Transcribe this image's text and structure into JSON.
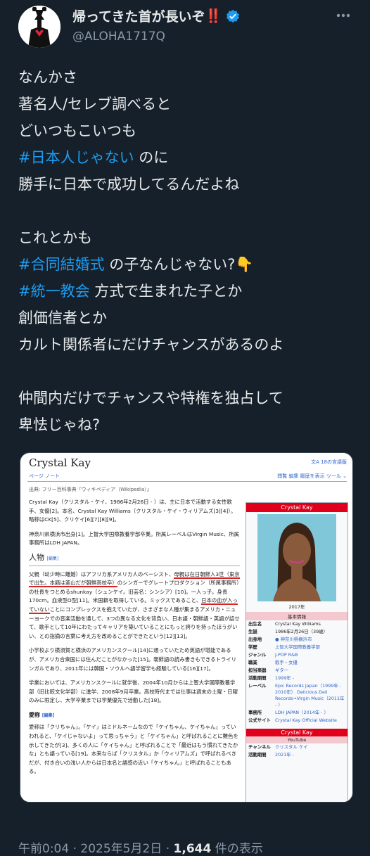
{
  "user": {
    "name": "帰ってきた首が長いぞ",
    "name_emoji": "‼️",
    "handle": "@ALOHA1717Q"
  },
  "tweet": {
    "lines": [
      {
        "parts": [
          {
            "t": "なんかさ"
          }
        ]
      },
      {
        "parts": [
          {
            "t": "著名人/セレブ調べると"
          }
        ]
      },
      {
        "parts": [
          {
            "t": "どいつもこいつも"
          }
        ]
      },
      {
        "parts": [
          {
            "t": "#日本人じゃない",
            "tag": true
          },
          {
            "t": " のに"
          }
        ]
      },
      {
        "parts": [
          {
            "t": "勝手に日本で成功してるんだよね"
          }
        ]
      },
      {
        "gap": true
      },
      {
        "parts": [
          {
            "t": "これとかも"
          }
        ]
      },
      {
        "parts": [
          {
            "t": "#合同結婚式",
            "tag": true
          },
          {
            "t": " の子なんじゃない?👇"
          }
        ]
      },
      {
        "parts": [
          {
            "t": "#統一教会",
            "tag": true
          },
          {
            "t": " 方式で生まれた子とか"
          }
        ]
      },
      {
        "parts": [
          {
            "t": "創価信者とか"
          }
        ]
      },
      {
        "parts": [
          {
            "t": "カルト関係者にだけチャンスがあるのよ"
          }
        ]
      },
      {
        "gap": true
      },
      {
        "parts": [
          {
            "t": "仲間内だけでチャンスや特権を独占して"
          }
        ]
      },
      {
        "parts": [
          {
            "t": "卑怯じゃね?"
          }
        ]
      }
    ]
  },
  "wiki": {
    "title": "Crystal Kay",
    "lang": "文A 18の言語版",
    "tabs_left": "ページ  ノート",
    "tabs_right": "閲覧  編集  履歴を表示  ツール ⌄",
    "from": "出典: フリー百科事典『ウィキペディア（Wikipedia）』",
    "intro": "Crystal Kay（クリスタル・ケイ、1986年2月26日 - ）は、主に日本で活動する女性歌手、女優[2]。本名、Crystal Kay Williams（クリスタル・ケイ・ウィリアムズ[3][4]）。略称はCK[5]、クリケイ[6][7][8][9]。",
    "intro2": "神奈川県横浜市出身[1]。上智大学国際教養学部卒業。所属レーベルはVirgin Music、所属事務所はLDH JAPAN。",
    "section1": "人物",
    "edit": "[編集]",
    "p1a": "父親（幼少時に離婚）はアフリカ系アメリカ人のベーシスト、",
    "p1b": "母親は在日朝鮮人3世",
    "p1c": "（東京で出生。本籍は釜山だが朝鮮高校卒）",
    "p1d": "のシンガーでグレートプロダクション（所属事務所）の社長をつとめるshunkay（シュンケイ。旧芸名：シンシア）[10]。一人っ子。身長170cm。血液型O型[11]。米国籍を取得している。ミックスであること、",
    "p1e": "日本の血が入っていない",
    "p1f": "ことにコンプレックスを抱えていたが、さまざまな人種が集まるアメリカ・ニューヨークでの音楽活動を通して、3つの異なる文化を背負い、日本語・朝鮮語・英語が話せて、歌手として10年にわたってキャリアを築いていることにもっと誇りを持ったほうがいい、との指摘の言葉に考え方を改めることができたという[12][13]。",
    "p2": "小学校より横須賀と横浜のアメリカンスクール[14]に通っていたため英語が堪能であるが、アメリカ合衆国には住んだことがなかった[15]。朝鮮語の読み書きもできるトライリンガルであり、2011年には韓国・ソウルへ語学留学も経験している[16][17]。",
    "p3": "学業においては、アメリカンスクールに就学後、2004年10月からは上智大学国際教養学部（旧比較文化学部）に進学、2008年9月卒業。高校時代までは仕事は週末の土曜・日曜のみに限定し、大学卒業までは学業優先で活動した[18]。",
    "section2": "愛称",
    "p4": "愛称は「クリちゃん」。「ケイ」はミドルネームなので「ケイちゃん、ケイちゃん」っていわれると、「ケイじゃないよ」って思っちゃう」と「ケイちゃん」と呼ばれることに難色を示してきたが[3]、多くの人に「ケイちゃん」と呼ばれることで「最近はもう慣れてきたかな」とも語っている[19]。本来ならば「クリスタル」か「ウィリアムズ」で呼ばれるべきだが、付き合いの浅い人からは日本名と語感の近い「ケイちゃん」と呼ばれることもある。"
  },
  "infobox": {
    "title": "Crystal Kay",
    "year": "2017年",
    "sub": "基本情報",
    "rows": [
      {
        "k": "出生名",
        "v": "Crystal Kay Williams",
        "link": false
      },
      {
        "k": "生誕",
        "v": "1986年2月26日（39歳）",
        "link": false
      },
      {
        "k": "出身地",
        "v": "● 神奈川県横浜市",
        "link": true
      },
      {
        "k": "学歴",
        "v": "上智大学国際教養学部",
        "link": true
      },
      {
        "k": "ジャンル",
        "v": "J-POP R&B",
        "link": true
      },
      {
        "k": "職業",
        "v": "歌手・女優",
        "link": true
      },
      {
        "k": "担当楽器",
        "v": "ギター",
        "link": true
      },
      {
        "k": "活動期間",
        "v": "1999年 -",
        "link": true
      },
      {
        "k": "レーベル",
        "v": "Epic Records Japan（1999年 - 2010年） Delicious Deli Records→Virgin Music（2011年 - ）",
        "link": true
      },
      {
        "k": "事務所",
        "v": "LDH JAPAN（2014年 - ）",
        "link": true
      },
      {
        "k": "公式サイト",
        "v": "Crystal Kay Official Website",
        "link": true
      }
    ],
    "title2": "Crystal Kay",
    "yt": "YouTube",
    "yt_rows": [
      {
        "k": "チャンネル",
        "v": "クリスタル ケイ",
        "link": true
      },
      {
        "k": "活動期間",
        "v": "2021年 -",
        "link": true
      }
    ]
  },
  "footer": {
    "time": "午前0:04",
    "dot1": " · ",
    "date": "2025年5月2日",
    "dot2": " · ",
    "views": "1,644",
    "views_label": " 件の表示"
  }
}
